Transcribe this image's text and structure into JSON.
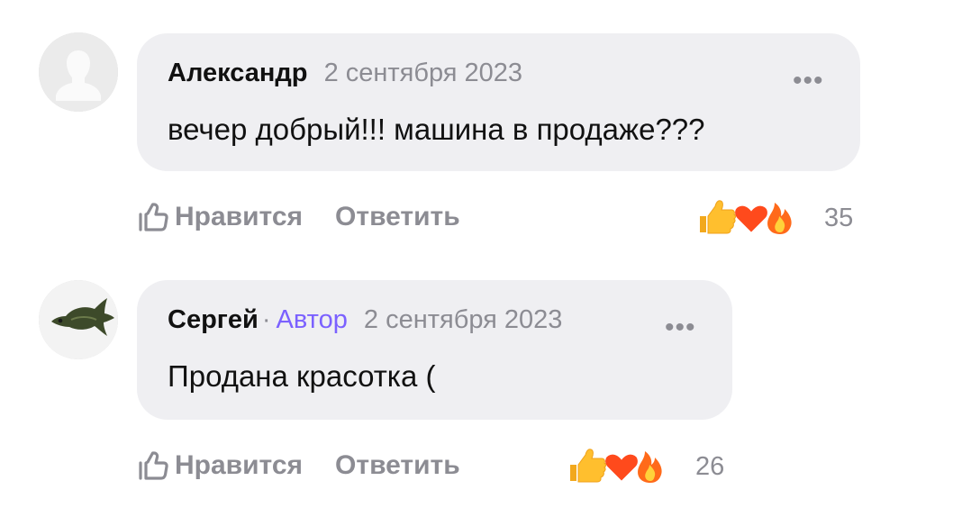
{
  "comments": [
    {
      "author": "Александр",
      "date": "2 сентября 2023",
      "text": "вечер добрый!!! машина в продаже???",
      "more": "•••",
      "like_label": "Нравится",
      "reply_label": "Ответить",
      "reactions": [
        "thumbs-up",
        "heart",
        "fire"
      ],
      "reaction_count": "35"
    },
    {
      "author": "Сергей",
      "author_separator": "·",
      "author_badge": "Автор",
      "date": "2 сентября 2023",
      "text": "Продана красотка (",
      "more": "•••",
      "like_label": "Нравится",
      "reply_label": "Ответить",
      "reactions": [
        "thumbs-up",
        "heart",
        "fire"
      ],
      "reaction_count": "26"
    }
  ],
  "colors": {
    "bubble": "#efeff2",
    "author_badge": "#7b61ff",
    "muted": "#8c8c93",
    "text": "#111111"
  }
}
